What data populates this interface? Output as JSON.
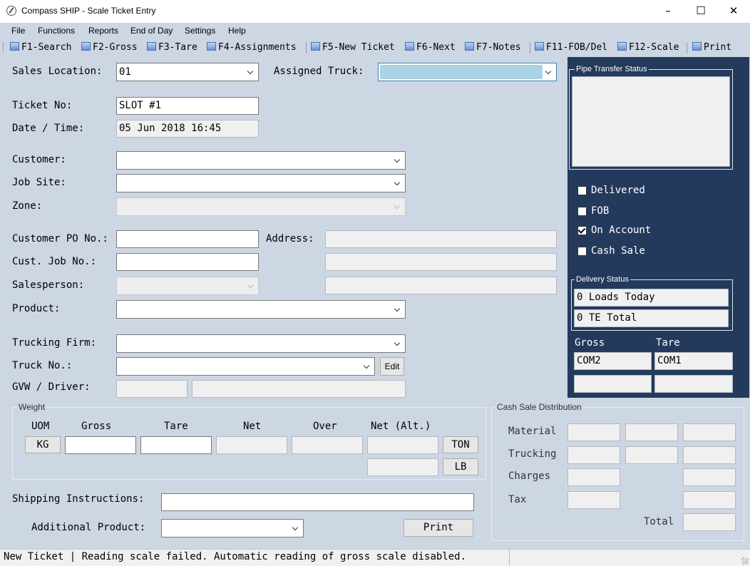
{
  "window": {
    "title": "Compass SHIP - Scale Ticket Entry",
    "minimize": "–",
    "maximize": "☐",
    "close": "✕"
  },
  "menu": [
    "File",
    "Functions",
    "Reports",
    "End of Day",
    "Settings",
    "Help"
  ],
  "toolbar": [
    "F1-Search",
    "F2-Gross",
    "F3-Tare",
    "F4-Assignments",
    "F5-New Ticket",
    "F6-Next",
    "F7-Notes",
    "F11-FOB/Del",
    "F12-Scale",
    "Print"
  ],
  "form": {
    "sales_location_label": "Sales Location:",
    "sales_location_value": "01",
    "assigned_truck_label": "Assigned Truck:",
    "assigned_truck_value": "",
    "ticket_no_label": "Ticket No:",
    "ticket_no_value": "SLOT #1",
    "date_time_label": "Date / Time:",
    "date_time_value": "05 Jun 2018 16:45",
    "customer_label": "Customer:",
    "job_site_label": "Job Site:",
    "zone_label": "Zone:",
    "customer_po_label": "Customer PO No.:",
    "address_label": "Address:",
    "cust_job_label": "Cust. Job No.:",
    "salesperson_label": "Salesperson:",
    "product_label": "Product:",
    "trucking_firm_label": "Trucking Firm:",
    "truck_no_label": "Truck No.:",
    "edit_button": "Edit",
    "gvw_driver_label": "GVW / Driver:",
    "shipping_instructions_label": "Shipping Instructions:",
    "additional_product_label": "Additional Product:",
    "print_button": "Print"
  },
  "weight": {
    "title": "Weight",
    "headers": [
      "UOM",
      "Gross",
      "Tare",
      "Net",
      "Over",
      "Net (Alt.)"
    ],
    "uom_value": "KG",
    "ton_button": "TON",
    "lb_button": "LB"
  },
  "cash_sale": {
    "title": "Cash Sale Distribution",
    "rows": [
      "Material",
      "Trucking",
      "Charges",
      "Tax"
    ],
    "total_label": "Total"
  },
  "right_panel": {
    "pipe_transfer_title": "Pipe Transfer Status",
    "checkboxes": [
      {
        "label": "Delivered",
        "checked": false
      },
      {
        "label": "FOB",
        "checked": false
      },
      {
        "label": "On Account",
        "checked": true
      },
      {
        "label": "Cash Sale",
        "checked": false
      }
    ],
    "delivery_status_title": "Delivery Status",
    "loads_today": "0 Loads Today",
    "te_total": "0 TE Total",
    "gross_label": "Gross",
    "tare_label": "Tare",
    "gross_port": "COM2",
    "tare_port": "COM1"
  },
  "status_bar": "New Ticket | Reading scale failed.  Automatic reading of gross scale disabled."
}
